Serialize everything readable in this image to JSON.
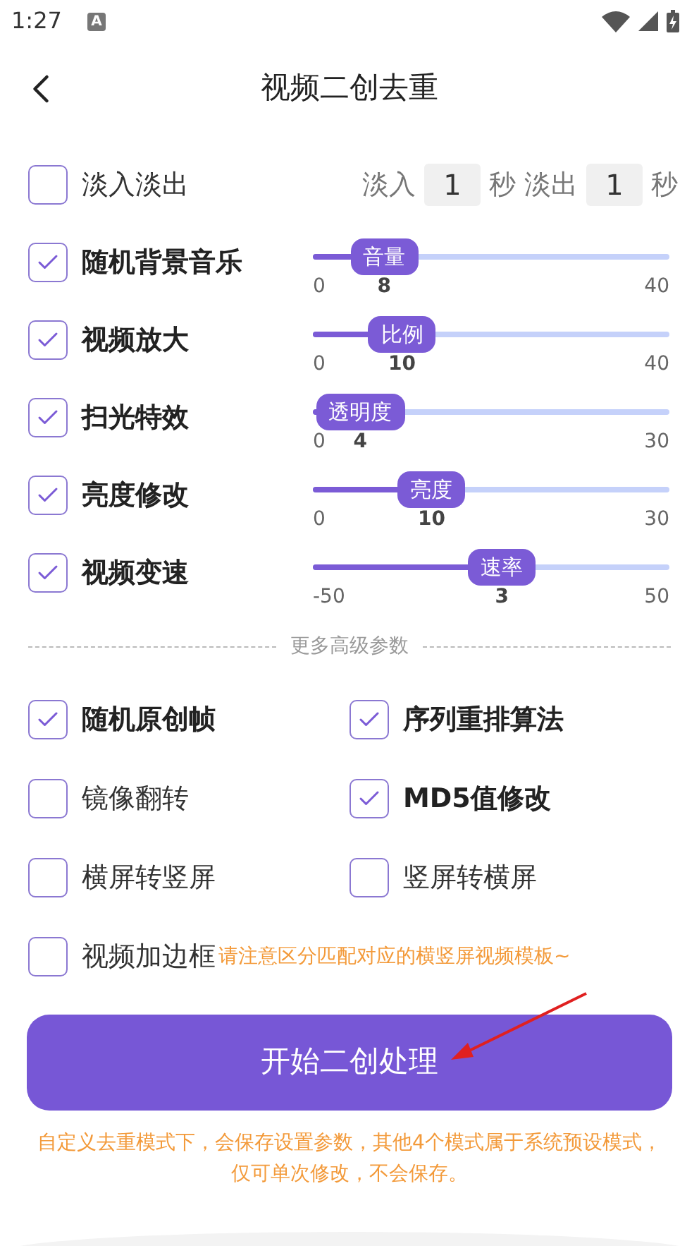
{
  "status_bar": {
    "time": "1:27",
    "badge": "A"
  },
  "header": {
    "title": "视频二创去重"
  },
  "fade": {
    "label": "淡入淡出",
    "checked": false,
    "fields": [
      {
        "label": "淡入",
        "value": "1",
        "unit": "秒"
      },
      {
        "label": "淡出",
        "value": "1",
        "unit": "秒"
      }
    ]
  },
  "effects": [
    {
      "label": "随机背景音乐",
      "checked": true,
      "slider_label": "音量",
      "min": "0",
      "max": "40",
      "value": "8",
      "level": 0.2
    },
    {
      "label": "视频放大",
      "checked": true,
      "slider_label": "比例",
      "min": "0",
      "max": "40",
      "value": "10",
      "level": 0.25
    },
    {
      "label": "扫光特效",
      "checked": true,
      "slider_label": "透明度",
      "min": "0",
      "max": "30",
      "value": "4",
      "level": 0.133
    },
    {
      "label": "亮度修改",
      "checked": true,
      "slider_label": "亮度",
      "min": "0",
      "max": "30",
      "value": "10",
      "level": 0.333
    },
    {
      "label": "视频变速",
      "checked": true,
      "slider_label": "速率",
      "min": "-50",
      "max": "50",
      "value": "3",
      "level": 0.53
    }
  ],
  "advanced_divider": "更多高级参数",
  "options": [
    {
      "label": "随机原创帧",
      "checked": true
    },
    {
      "label": "序列重排算法",
      "checked": true
    },
    {
      "label": "镜像翻转",
      "checked": false
    },
    {
      "label": "MD5值修改",
      "checked": true
    },
    {
      "label": "横屏转竖屏",
      "checked": false
    },
    {
      "label": "竖屏转横屏",
      "checked": false
    }
  ],
  "border_option": {
    "label": "视频加边框",
    "checked": false,
    "hint": "请注意区分匹配对应的横竖屏视频模板~"
  },
  "start_button": "开始二创处理",
  "note": "自定义去重模式下，会保存设置参数，其他4个模式属于系统预设模式，仅可单次修改，不会保存。"
}
